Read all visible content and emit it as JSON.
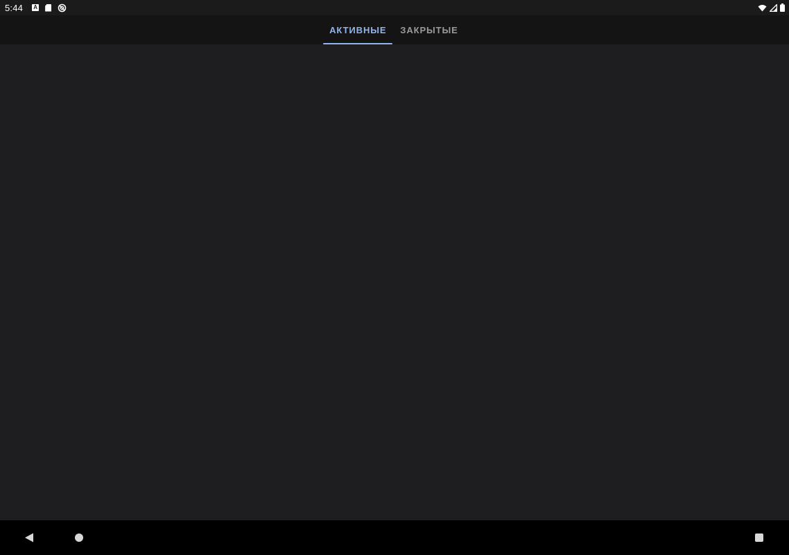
{
  "status_bar": {
    "time": "5:44",
    "left_icons": [
      "a-badge-icon",
      "sd-card-icon",
      "data-saver-icon"
    ],
    "right_icons": [
      "wifi-icon",
      "signal-icon",
      "battery-icon"
    ]
  },
  "tabs": [
    {
      "label": "АКТИВНЫЕ",
      "selected": true
    },
    {
      "label": "ЗАКРЫТЫЕ",
      "selected": false
    }
  ],
  "colors": {
    "accent": "#8fb4ee",
    "background": "#1e1e20",
    "tab_bar": "#141414",
    "inactive_tab_text": "#9a9a9c"
  },
  "nav_bar": {
    "buttons": [
      "back-icon",
      "home-icon",
      "recents-icon"
    ]
  }
}
